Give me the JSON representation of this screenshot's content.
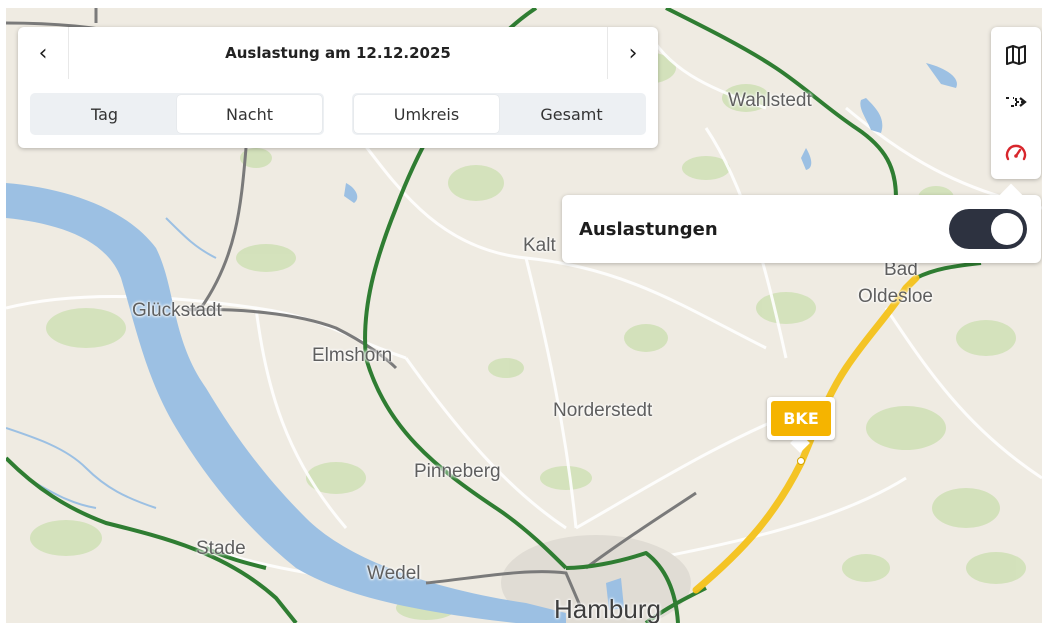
{
  "header": {
    "title": "Auslastung am 12.12.2025",
    "prev_glyph": "‹",
    "next_glyph": "›"
  },
  "time_toggle": {
    "options": [
      "Tag",
      "Nacht"
    ],
    "selected": "Nacht"
  },
  "scope_toggle": {
    "options": [
      "Umkreis",
      "Gesamt"
    ],
    "selected": "Umkreis"
  },
  "toolbar": {
    "items": [
      {
        "icon": "map-icon"
      },
      {
        "icon": "route-icon"
      },
      {
        "icon": "gauge-icon",
        "active": true
      }
    ]
  },
  "popup": {
    "label": "Auslastungen",
    "toggle_on": true
  },
  "station_marker": {
    "label": "BKE"
  },
  "places": [
    "Wahlstedt",
    "Kalt",
    "Bad",
    "Oldesloe",
    "Glückstadt",
    "Elmshorn",
    "Norderstedt",
    "Pinneberg",
    "Stade",
    "Wedel",
    "Hamburg"
  ],
  "colors": {
    "water": "#9cc0e3",
    "railway_line": "#2f7d32",
    "highlighted_route": "#f3c21a",
    "accent_red": "#d8262c",
    "toggle_on": "#2d3240",
    "map_land": "#efebe2",
    "map_green": "#cfe0b5"
  }
}
